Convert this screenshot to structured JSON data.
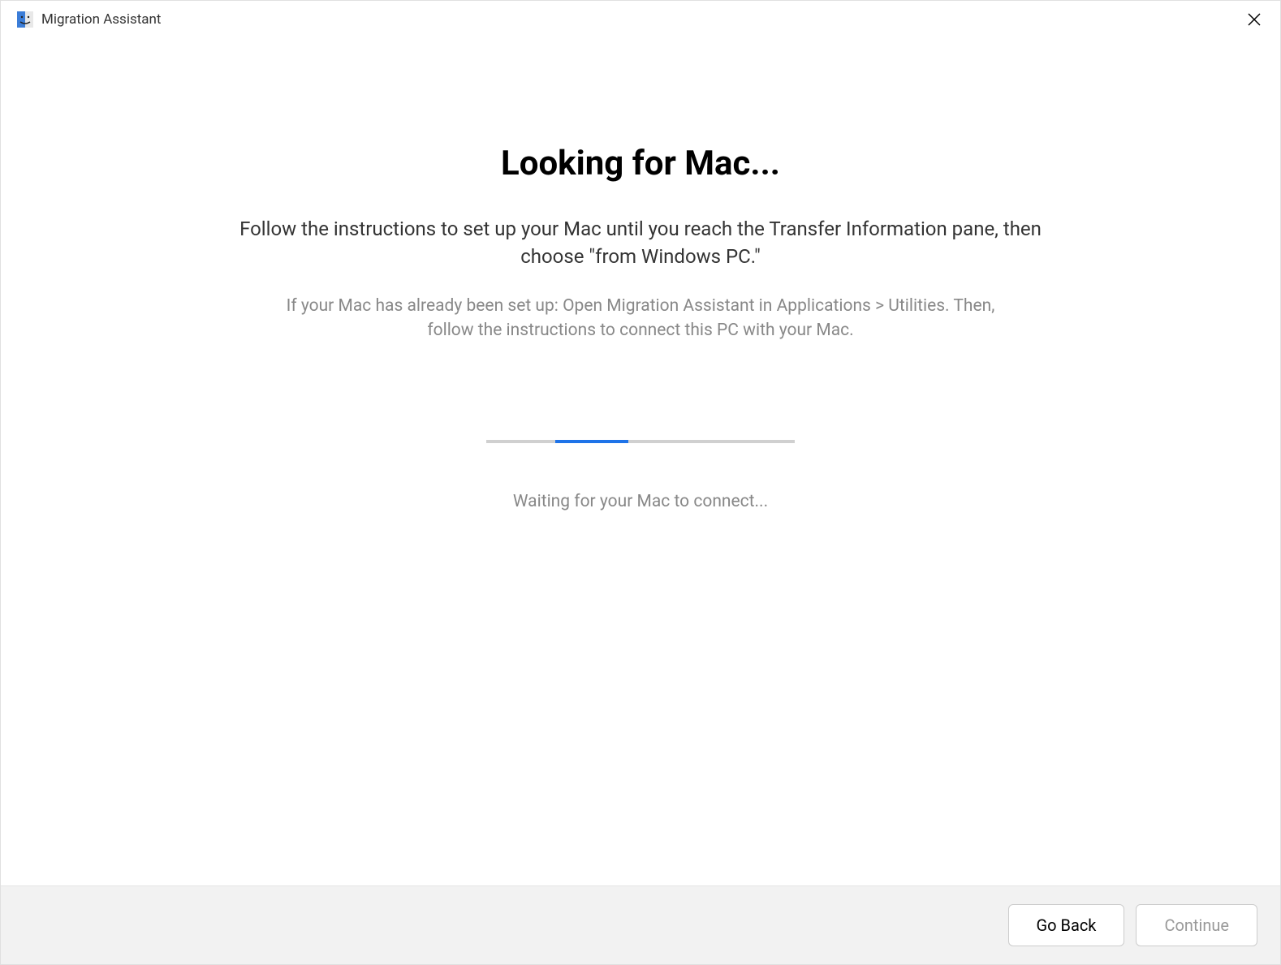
{
  "titlebar": {
    "app_name": "Migration Assistant"
  },
  "main": {
    "heading": "Looking for Mac...",
    "instruction_primary": "Follow the instructions to set up your Mac until you reach the Transfer Information pane, then choose \"from Windows PC.\"",
    "instruction_secondary": "If your Mac has already been set up: Open Migration Assistant in Applications > Utilities. Then, follow the instructions to connect this PC with your Mac.",
    "status_text": "Waiting for your Mac to connect..."
  },
  "footer": {
    "go_back_label": "Go Back",
    "continue_label": "Continue"
  }
}
